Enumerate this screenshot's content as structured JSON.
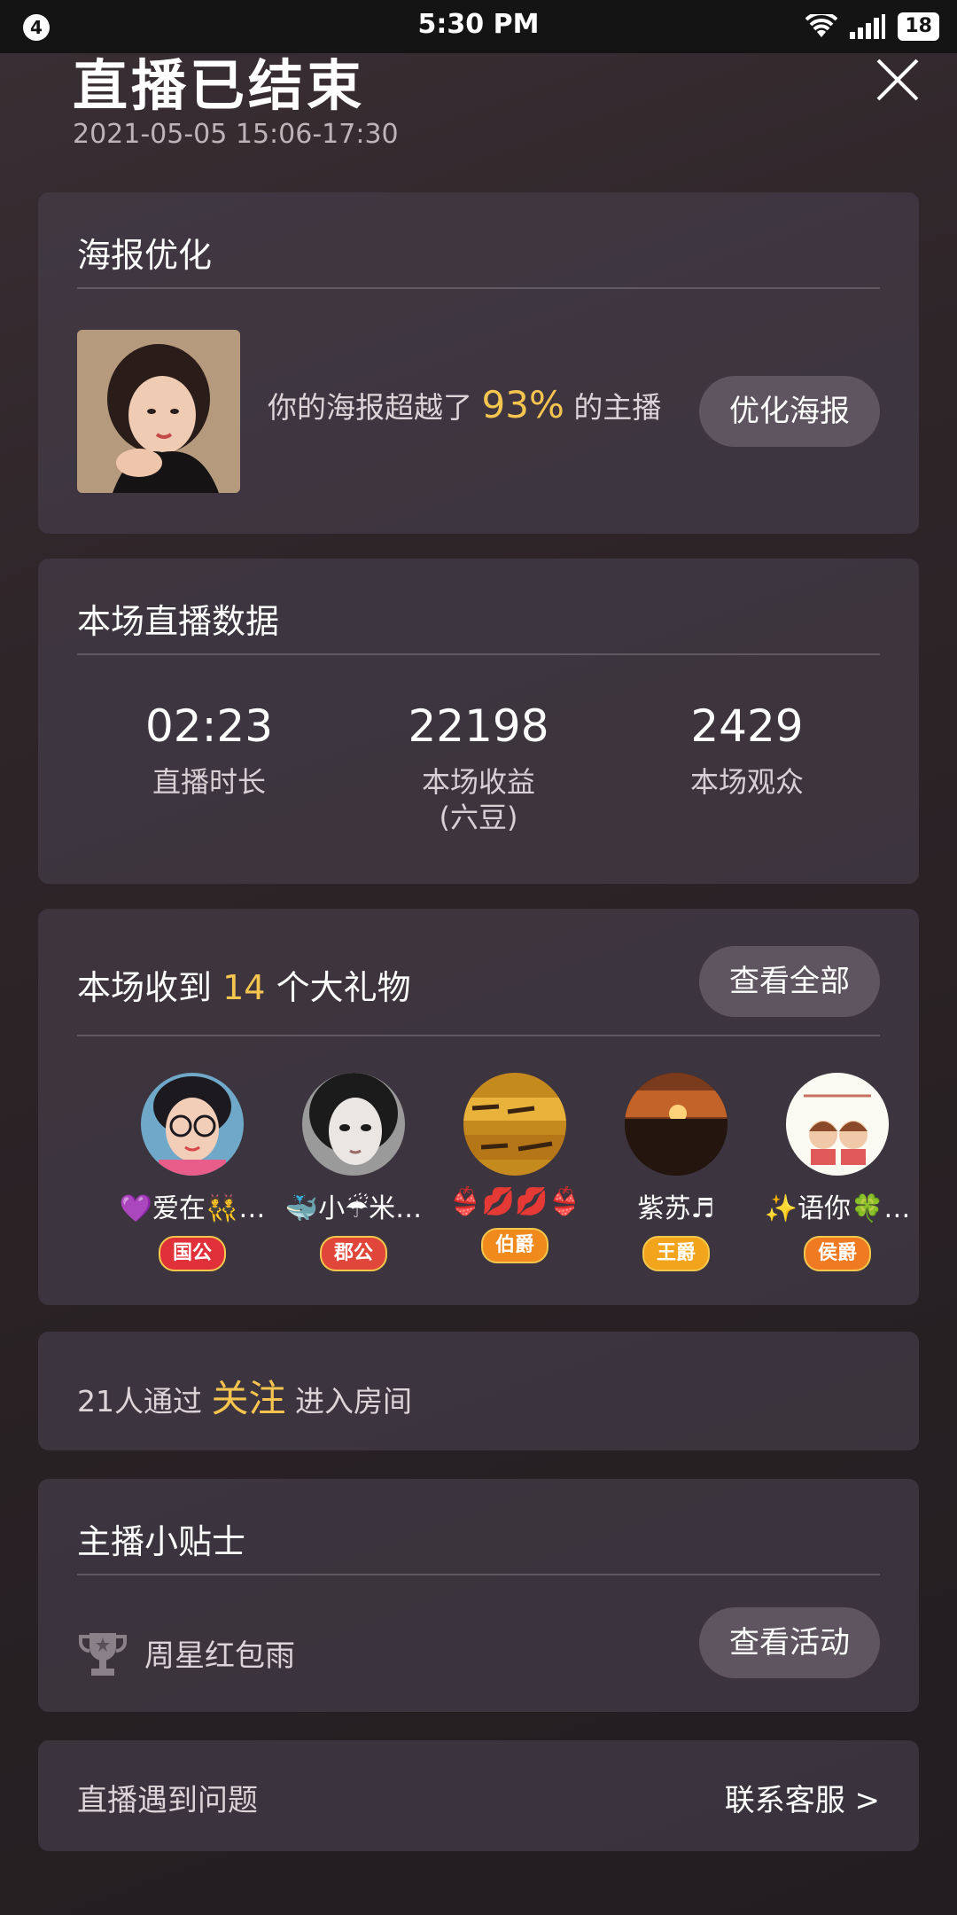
{
  "status_bar": {
    "notification_count": "4",
    "time": "5:30 PM",
    "battery": "18",
    "icons": [
      "wifi-icon",
      "signal-icon",
      "battery-icon"
    ]
  },
  "header": {
    "title": "直播已结束",
    "time_range": "2021-05-05 15:06-17:30",
    "close_icon": "close-icon"
  },
  "poster": {
    "title": "海报优化",
    "text_before": "你的海报超越了",
    "percent": "93%",
    "text_after": "的主播",
    "button": "优化海报"
  },
  "stats": {
    "title": "本场直播数据",
    "items": [
      {
        "value": "02:23",
        "label": "直播时长"
      },
      {
        "value": "22198",
        "label": "本场收益\n(六豆)"
      },
      {
        "value": "2429",
        "label": "本场观众"
      }
    ]
  },
  "gifts": {
    "title_before": "本场收到",
    "count": "14",
    "title_after": "个大礼物",
    "button": "查看全部",
    "users": [
      {
        "name": "💜爱在👯…",
        "badge": "国公",
        "badge_color": "#e0313a"
      },
      {
        "name": "🐳小☔米…",
        "badge": "郡公",
        "badge_color": "#e0473a"
      },
      {
        "name": "👙💋💋👙",
        "badge": "伯爵",
        "badge_color": "#f08a1d"
      },
      {
        "name": "紫苏♬",
        "badge": "王爵",
        "badge_color": "#f2a51c"
      },
      {
        "name": "✨语你🍀…",
        "badge": "侯爵",
        "badge_color": "#f07a22"
      }
    ]
  },
  "follow": {
    "text_before": "21人通过",
    "highlight": "关注",
    "text_after": "进入房间"
  },
  "tips": {
    "title": "主播小贴士",
    "item": "周星红包雨",
    "item_icon": "trophy-icon",
    "button": "查看活动"
  },
  "problem": {
    "text": "直播遇到问题",
    "link": "联系客服 >"
  }
}
